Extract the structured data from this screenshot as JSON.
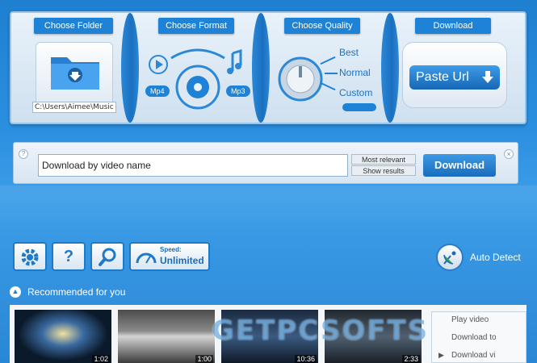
{
  "top": {
    "folder": {
      "title": "Choose Folder",
      "path": "C:\\Users\\Aimee\\Music"
    },
    "format": {
      "title": "Choose Format",
      "left_tag": "Mp4",
      "right_tag": "Mp3"
    },
    "quality": {
      "title": "Choose Quality",
      "options": [
        "Best",
        "Normal",
        "Custom"
      ]
    },
    "download": {
      "title": "Download",
      "paste_label": "Paste Url"
    }
  },
  "search": {
    "value": "Download by video name",
    "help_glyph": "?",
    "close_glyph": "×",
    "relevance_label": "Most relevant",
    "show_results_label": "Show results",
    "download_label": "Download"
  },
  "toolbar": {
    "speed_caption": "Speed:",
    "speed_value": "Unlimited",
    "settings_icon": "gear-icon",
    "help_glyph": "?",
    "search_icon": "search-icon",
    "auto_detect_label": "Auto Detect"
  },
  "recommended": {
    "arrow_glyph": "▲",
    "label": "Recommended for you",
    "thumbnails": [
      {
        "duration": "1:02"
      },
      {
        "duration": "1:00"
      },
      {
        "duration": "10:36"
      },
      {
        "duration": "2:33"
      }
    ],
    "context_menu": [
      "Play video",
      "Download to",
      "Download vi"
    ]
  },
  "watermark": "GETPCSOFTS",
  "colors": {
    "accent": "#1e82d6",
    "panel": "#e9f2fa"
  }
}
